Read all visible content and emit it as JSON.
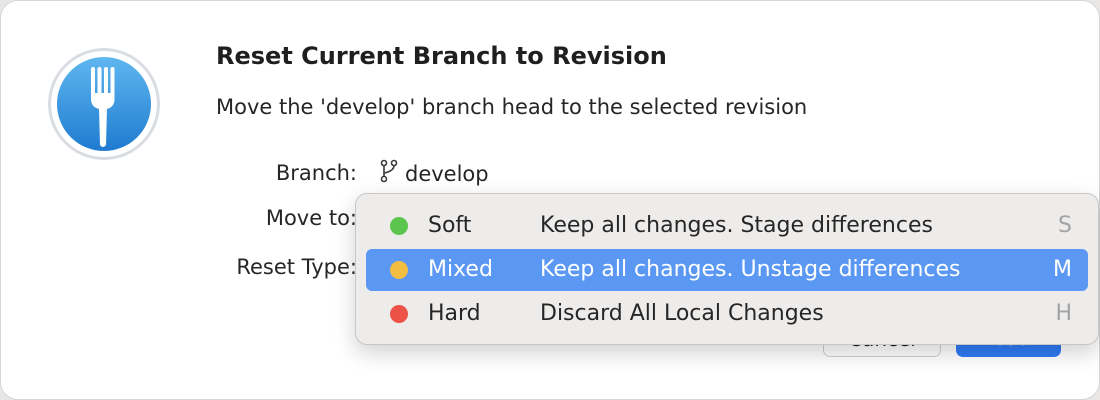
{
  "dialog": {
    "title": "Reset Current Branch to Revision",
    "subtitle": "Move the 'develop' branch head to the selected revision",
    "app_icon": "fork-app-icon"
  },
  "form": {
    "branch_label": "Branch:",
    "branch_value": "develop",
    "branch_icon": "git-branch-icon",
    "move_to_label": "Move to:",
    "reset_type_label": "Reset Type:"
  },
  "reset_menu": {
    "selected": "Mixed",
    "items": [
      {
        "name": "Soft",
        "description": "Keep all changes. Stage differences",
        "shortcut": "S",
        "color": "#5bc54e"
      },
      {
        "name": "Mixed",
        "description": "Keep all changes. Unstage differences",
        "shortcut": "M",
        "color": "#f3bd41"
      },
      {
        "name": "Hard",
        "description": "Discard All Local Changes",
        "shortcut": "H",
        "color": "#ec5246"
      }
    ]
  },
  "buttons": {
    "cancel_label": "Cancel",
    "reset_label": "Reset",
    "accent": "#2f7bf5"
  }
}
